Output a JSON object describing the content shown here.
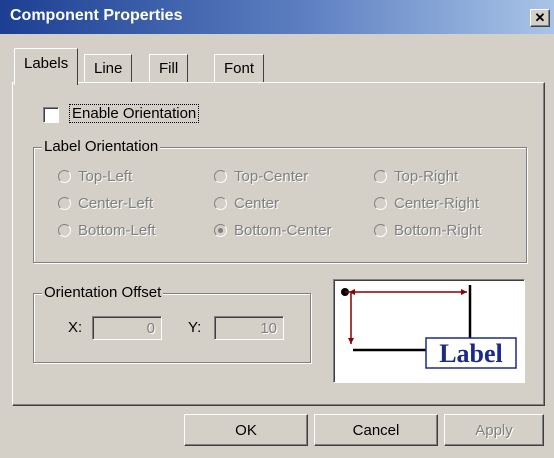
{
  "window": {
    "title": "Component Properties",
    "close_glyph": "✕"
  },
  "tabs": [
    {
      "label": "Labels",
      "active": true
    },
    {
      "label": "Line"
    },
    {
      "label": "Fill"
    },
    {
      "label": "Font"
    }
  ],
  "enable_orientation": {
    "label": "Enable Orientation",
    "checked": false
  },
  "label_orientation": {
    "legend": "Label Orientation",
    "options": [
      "Top-Left",
      "Top-Center",
      "Top-Right",
      "Center-Left",
      "Center",
      "Center-Right",
      "Bottom-Left",
      "Bottom-Center",
      "Bottom-Right"
    ],
    "selected": "Bottom-Center"
  },
  "orientation_offset": {
    "legend": "Orientation Offset",
    "x_label": "X:",
    "x_value": "0",
    "y_label": "Y:",
    "y_value": "10"
  },
  "preview": {
    "label_text": "Label",
    "line_color": "#8b0000",
    "text_color": "#1a2a8a"
  },
  "buttons": {
    "ok": "OK",
    "cancel": "Cancel",
    "apply": "Apply"
  },
  "colors": {
    "face": "#d4d0c8",
    "title_start": "#1c3f93",
    "title_end": "#a8c4e8"
  }
}
